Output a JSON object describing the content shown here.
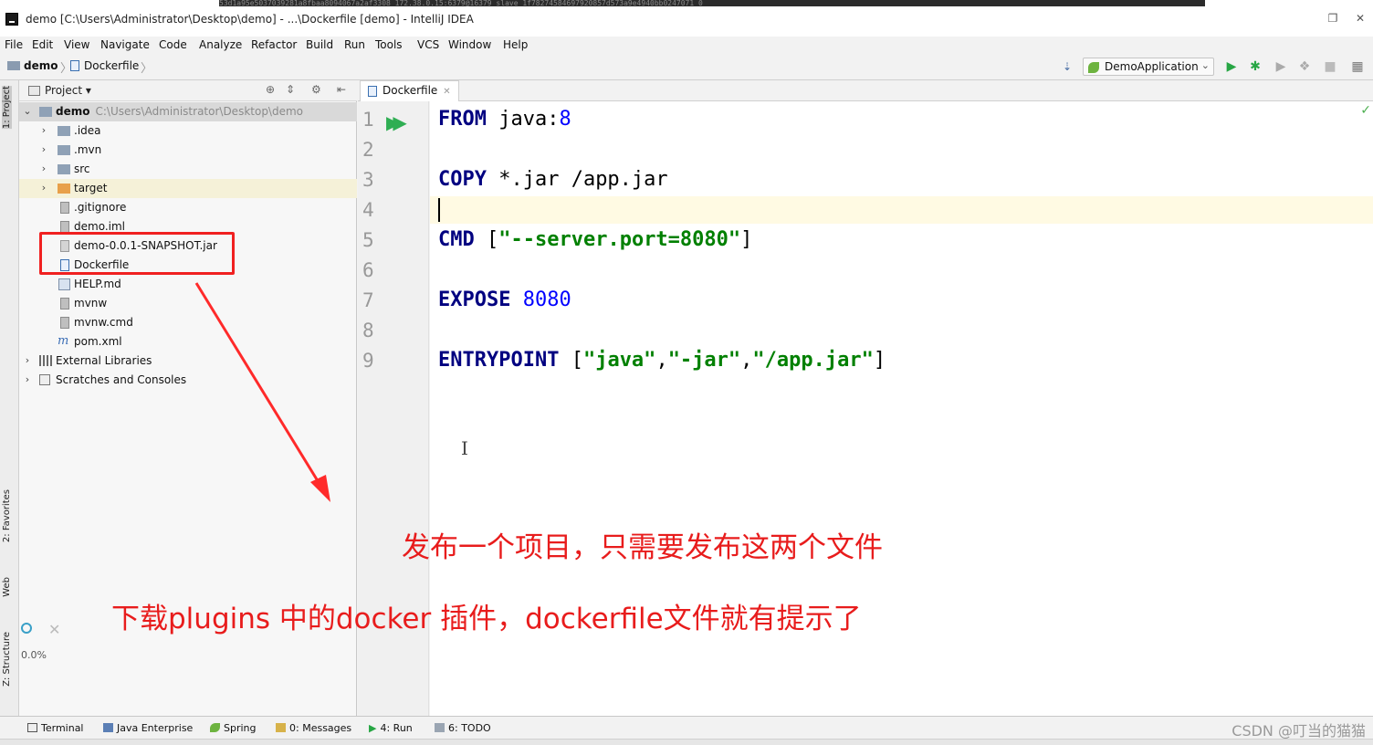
{
  "window": {
    "title": "demo [C:\\Users\\Administrator\\Desktop\\demo] - ...\\Dockerfile [demo] - IntelliJ IDEA",
    "overlay_text": "53d1a95e5037039281a8fbaa8094067a2af3308  172.38.0.15:6379@16379 slave 1f78274584697920857d573a9e4940bb0247071 0"
  },
  "menu": [
    "File",
    "Edit",
    "View",
    "Navigate",
    "Code",
    "Analyze",
    "Refactor",
    "Build",
    "Run",
    "Tools",
    "VCS",
    "Window",
    "Help"
  ],
  "breadcrumb": {
    "project": "demo",
    "file": "Dockerfile"
  },
  "run_config": {
    "label": "DemoApplication"
  },
  "left_tabs": {
    "project": "1: Project",
    "favorites": "2: Favorites",
    "web": "Web",
    "structure": "Z: Structure"
  },
  "project_pane": {
    "title": "Project",
    "root": {
      "name": "demo",
      "path": "C:\\Users\\Administrator\\Desktop\\demo"
    },
    "items": [
      {
        "label": ".idea"
      },
      {
        "label": ".mvn"
      },
      {
        "label": "src"
      },
      {
        "label": "target"
      },
      {
        "label": ".gitignore"
      },
      {
        "label": "demo.iml"
      },
      {
        "label": "demo-0.0.1-SNAPSHOT.jar"
      },
      {
        "label": "Dockerfile"
      },
      {
        "label": "HELP.md"
      },
      {
        "label": "mvnw"
      },
      {
        "label": "mvnw.cmd"
      },
      {
        "label": "pom.xml"
      },
      {
        "label": "External Libraries"
      },
      {
        "label": "Scratches and Consoles"
      }
    ],
    "progress": "0.0%"
  },
  "editor": {
    "tab": "Dockerfile",
    "line_numbers": [
      "1",
      "2",
      "3",
      "4",
      "5",
      "6",
      "7",
      "8",
      "9"
    ],
    "lines": {
      "l1_kw": "FROM",
      "l1_rest": " java:",
      "l1_num": "8",
      "l3_kw": "COPY",
      "l3_rest": " *.jar /app.jar",
      "l5_kw": "CMD",
      "l5_open": " [",
      "l5_str": "\"--server.port=8080\"",
      "l5_close": "]",
      "l7_kw": "EXPOSE",
      "l7_num": " 8080",
      "l9_kw": "ENTRYPOINT",
      "l9_open": " [",
      "l9_s1": "\"java\"",
      "l9_c1": ",",
      "l9_s2": "\"-jar\"",
      "l9_c2": ",",
      "l9_s3": "\"/app.jar\"",
      "l9_close": "]"
    }
  },
  "annotations": {
    "line1": "发布一个项目，只需要发布这两个文件",
    "line2": "下载plugins 中的docker  插件，dockerfile文件就有提示了"
  },
  "bottom_tools": [
    "Terminal",
    "Java Enterprise",
    "Spring",
    "0: Messages",
    "4: Run",
    "6: TODO"
  ],
  "watermark": "CSDN @叮当的猫猫",
  "colors": {
    "annotation_red": "#e81c1c",
    "keyword": "#000080",
    "string": "#008000",
    "number": "#0000ff"
  }
}
